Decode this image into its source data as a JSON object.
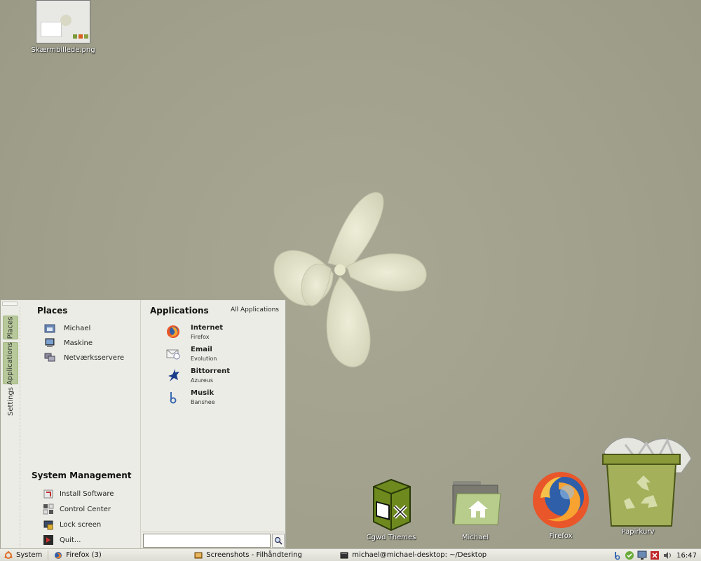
{
  "desktop": {
    "icons": [
      {
        "label": "Skærmbillede.png",
        "icon": "image-file-icon"
      }
    ]
  },
  "menu": {
    "tabs": [
      {
        "label": "Places",
        "active": true
      },
      {
        "label": "Applications",
        "active": true
      },
      {
        "label": "Settings",
        "active": false
      }
    ],
    "places": {
      "title": "Places",
      "items": [
        {
          "label": "Michael",
          "icon": "home-folder-icon"
        },
        {
          "label": "Maskine",
          "icon": "computer-icon"
        },
        {
          "label": "Netværksservere",
          "icon": "network-icon"
        }
      ]
    },
    "system_management": {
      "title": "System Management",
      "items": [
        {
          "label": "Install Software",
          "icon": "install-software-icon"
        },
        {
          "label": "Control Center",
          "icon": "control-center-icon"
        },
        {
          "label": "Lock screen",
          "icon": "lock-screen-icon"
        },
        {
          "label": "Quit...",
          "icon": "quit-icon"
        }
      ]
    },
    "applications": {
      "title": "Applications",
      "all_link": "All Applications",
      "items": [
        {
          "title": "Internet",
          "subtitle": "Firefox",
          "icon": "firefox-icon"
        },
        {
          "title": "Email",
          "subtitle": "Evolution",
          "icon": "email-icon"
        },
        {
          "title": "Bittorrent",
          "subtitle": "Azureus",
          "icon": "bittorrent-icon"
        },
        {
          "title": "Musik",
          "subtitle": "Banshee",
          "icon": "music-icon"
        }
      ]
    },
    "search": {
      "value": ""
    }
  },
  "dock": [
    {
      "label": "Cgwd Themes",
      "icon": "cgwd-themes-icon"
    },
    {
      "label": "Michael",
      "icon": "home-folder-icon"
    },
    {
      "label": "Firefox",
      "icon": "firefox-icon"
    },
    {
      "label": "Papirkurv",
      "icon": "trash-icon"
    }
  ],
  "taskbar": {
    "system_label": "System",
    "tasks": [
      {
        "label": "Firefox (3)",
        "icon": "firefox-icon"
      },
      {
        "label": "Screenshots - Filhåndtering",
        "icon": "file-manager-icon"
      },
      {
        "label": "michael@michael-desktop: ~/Desktop",
        "icon": "terminal-icon"
      }
    ],
    "clock": "16:47"
  },
  "colors": {
    "desktop": "#a0a08c",
    "menu_bg": "#ecece6",
    "tab_active": "#b7c99a",
    "trash_green": "#a4b05a"
  }
}
